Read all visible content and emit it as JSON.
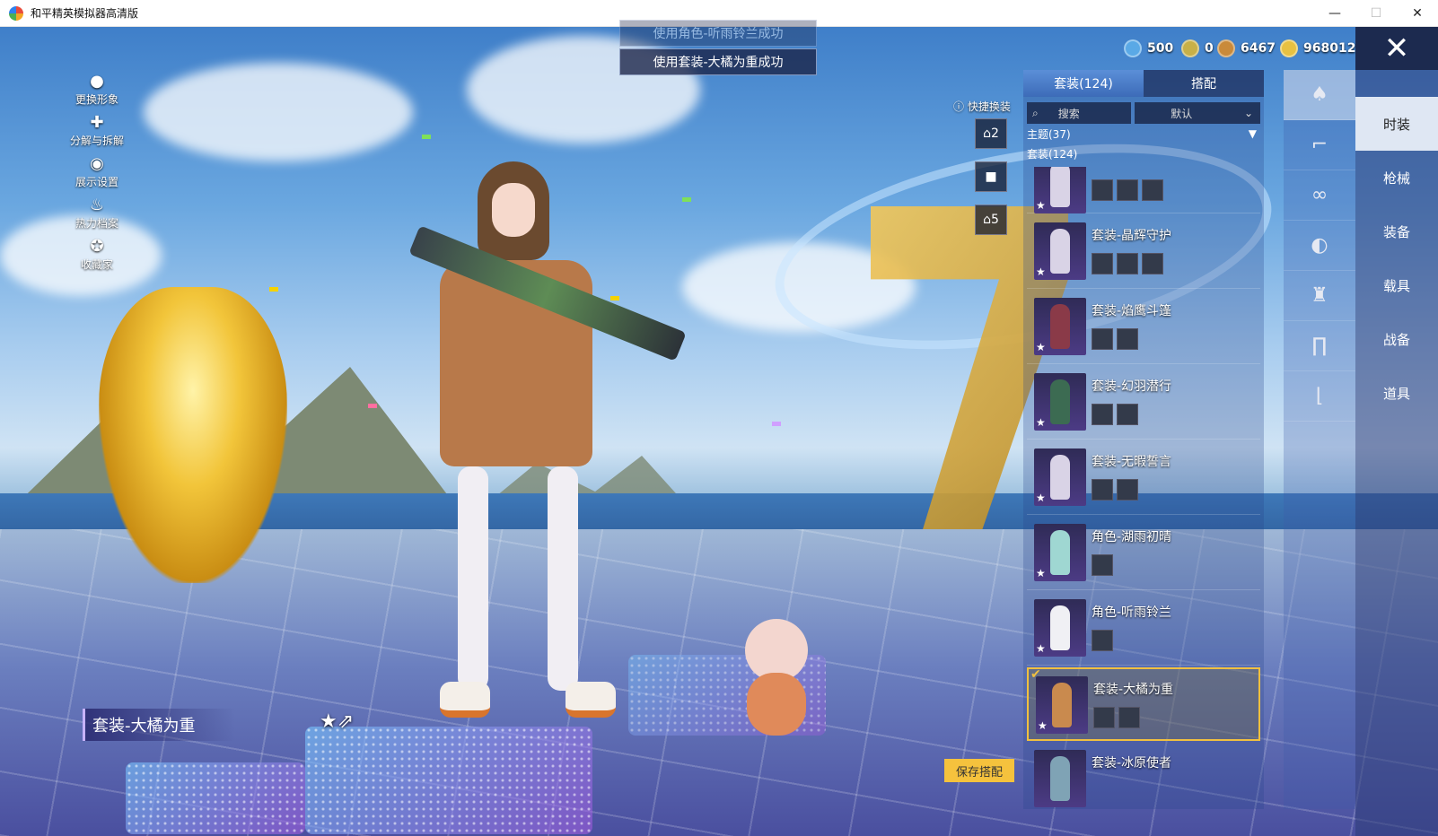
{
  "window": {
    "title": "和平精英模拟器高清版",
    "minimize": "—",
    "maximize": "☐",
    "close": "✕"
  },
  "toasts": {
    "faded": "使用角色-听雨铃兰成功",
    "main": "使用套装-大橘为重成功"
  },
  "currency": [
    {
      "icon": "globe-coin-icon",
      "value": "500",
      "color": "#5aa9e6"
    },
    {
      "icon": "gold-token-icon",
      "value": "0",
      "color": "#c8b048"
    },
    {
      "icon": "bronze-coin-icon",
      "value": "6467",
      "color": "#c98a3a"
    },
    {
      "icon": "gold-coin-icon",
      "value": "968012",
      "color": "#e7c142"
    }
  ],
  "left_menu": [
    {
      "icon": "avatar-icon",
      "label": "更换形象"
    },
    {
      "icon": "puzzle-icon",
      "label": "分解与拆解"
    },
    {
      "icon": "eye-icon",
      "label": "展示设置"
    },
    {
      "icon": "fire-icon",
      "label": "热力档案"
    },
    {
      "icon": "collector-badge-icon",
      "label": "收藏家"
    }
  ],
  "outfit_label": "套装-大橘为重",
  "quick_change": {
    "label": "快捷换装",
    "slots": [
      "2",
      "",
      "5"
    ]
  },
  "panel": {
    "tabs": [
      "套装(124)",
      "搭配"
    ],
    "search_label": "搜索",
    "sort_label": "默认",
    "groups": [
      "主题(37)",
      "套装(124)"
    ],
    "items": [
      {
        "name": "",
        "parts": 3
      },
      {
        "name": "套装-晶辉守护",
        "parts": 3
      },
      {
        "name": "套装-焰鹰斗篷",
        "parts": 2
      },
      {
        "name": "套装-幻羽潜行",
        "parts": 2
      },
      {
        "name": "套装-无暇誓言",
        "parts": 2
      },
      {
        "name": "角色-湖雨初晴",
        "parts": 1
      },
      {
        "name": "角色-听雨铃兰",
        "parts": 1
      },
      {
        "name": "套装-大橘为重",
        "parts": 2,
        "selected": true
      },
      {
        "name": "套装-冰原使者",
        "parts": 0
      }
    ],
    "save_button": "保存搭配"
  },
  "icon_column": [
    "outfit-icon",
    "shoes-icon",
    "glasses-icon",
    "mask-icon",
    "jacket-icon",
    "pants-icon",
    "socks-icon"
  ],
  "categories": [
    "时装",
    "枪械",
    "装备",
    "载具",
    "战备",
    "道具"
  ]
}
